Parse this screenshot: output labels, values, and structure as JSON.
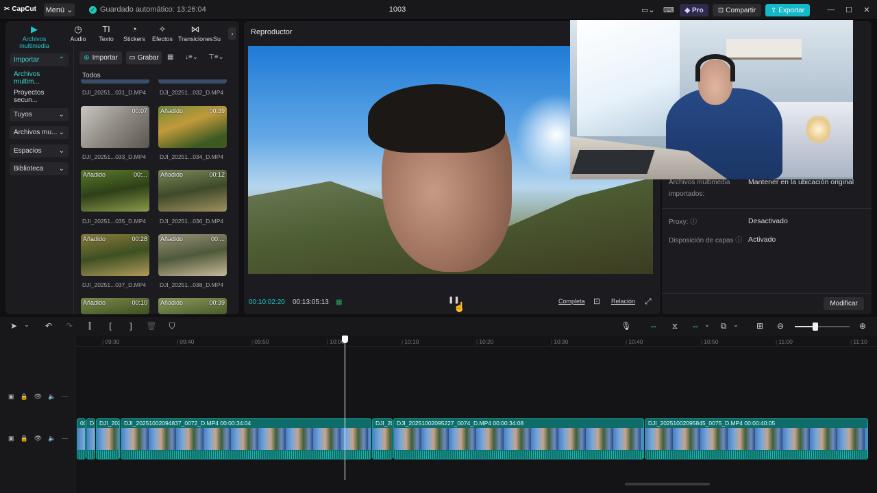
{
  "app": {
    "logo": "CapCut",
    "menu_label": "Menú",
    "autosave": "Guardado automático: 13:26:04",
    "project_title": "1003",
    "pro_label": "Pro",
    "share_label": "Compartir",
    "export_label": "Exportar"
  },
  "tabs": [
    {
      "label": "Archivos multimedia",
      "icon": "media-icon"
    },
    {
      "label": "Audio",
      "icon": "audio-icon"
    },
    {
      "label": "Texto",
      "icon": "text-icon"
    },
    {
      "label": "Stickers",
      "icon": "stickers-icon"
    },
    {
      "label": "Efectos",
      "icon": "effects-icon"
    },
    {
      "label": "Transiciones",
      "icon": "transitions-icon"
    },
    {
      "label": "Su",
      "icon": "subtitles-icon"
    }
  ],
  "sidebar": [
    {
      "label": "Importar"
    },
    {
      "label": "Archivos multim..."
    },
    {
      "label": "Proyectos secun..."
    },
    {
      "label": "Tuyos"
    },
    {
      "label": "Archivos mu..."
    },
    {
      "label": "Espacios"
    },
    {
      "label": "Biblioteca"
    }
  ],
  "media": {
    "import_label": "Importar",
    "record_label": "Grabar",
    "filter_label": "Todos",
    "top_names": [
      "DJI_20251...031_D.MP4",
      "DJI_20251...032_D.MP4"
    ],
    "items": [
      {
        "name": "DJI_20251...033_D.MP4",
        "badge": "",
        "duration": "00:07"
      },
      {
        "name": "DJI_20251...034_D.MP4",
        "badge": "Añadido",
        "duration": "00:39"
      },
      {
        "name": "DJI_20251...035_D.MP4",
        "badge": "Añadido",
        "duration": "00:..."
      },
      {
        "name": "DJI_20251...036_D.MP4",
        "badge": "Añadido",
        "duration": "00:12"
      },
      {
        "name": "DJI_20251...037_D.MP4",
        "badge": "Añadido",
        "duration": "00:28"
      },
      {
        "name": "DJI_20251...038_D.MP4",
        "badge": "Añadido",
        "duration": "00:..."
      },
      {
        "name": "",
        "badge": "Añadido",
        "duration": "00:10"
      },
      {
        "name": "",
        "badge": "Añadido",
        "duration": "00:39"
      }
    ]
  },
  "player": {
    "title": "Reproductor",
    "current_time": "00:10:02:20",
    "total_time": "00:13:05:13",
    "full_label": "Completa",
    "ratio_label": "Relación"
  },
  "details": {
    "rows": [
      {
        "label": "Archivos multimedia importados:",
        "value": "Mantener en la ubicación original"
      },
      {
        "label": "Proxy:",
        "value": "Desactivado"
      },
      {
        "label": "Disposición de capas",
        "value": "Activado"
      }
    ],
    "modify_label": "Modificar"
  },
  "timeline": {
    "ticks": [
      "09:30",
      "09:40",
      "09:50",
      "10:00",
      "10:10",
      "10:20",
      "10:30",
      "10:40",
      "10:50",
      "11:00",
      "11:10"
    ],
    "clips": [
      {
        "label": "00"
      },
      {
        "label": "D"
      },
      {
        "label": "DJI_202"
      },
      {
        "label": "DJI_20251002094837_0072_D.MP4   00:00:34:04"
      },
      {
        "label": "DJI_20"
      },
      {
        "label": "DJI_20251002095227_0074_D.MP4   00:00:34:08"
      },
      {
        "label": "DJI_20251002095845_0075_D.MP4   00:00:40:05"
      }
    ]
  }
}
